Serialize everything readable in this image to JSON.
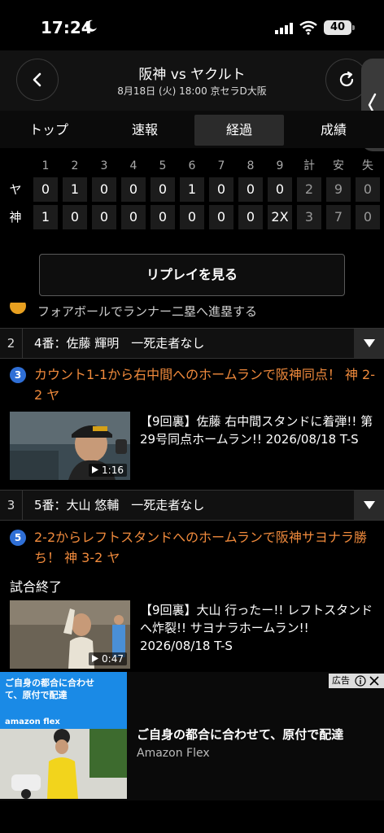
{
  "status": {
    "time": "17:24",
    "battery": "40"
  },
  "header": {
    "title": "阪神 vs ヤクルト",
    "subtitle": "8月18日 (火) 18:00 京セラD大阪"
  },
  "tabs": [
    {
      "label": "トップ"
    },
    {
      "label": "速報"
    },
    {
      "label": "経過",
      "active": true
    },
    {
      "label": "成績"
    }
  ],
  "scoreboard": {
    "headers": [
      "1",
      "2",
      "3",
      "4",
      "5",
      "6",
      "7",
      "8",
      "9",
      "計",
      "安",
      "失"
    ],
    "rows": [
      {
        "team": "ヤ",
        "cells": [
          "0",
          "1",
          "0",
          "0",
          "0",
          "1",
          "0",
          "0",
          "0",
          "2",
          "9",
          "0"
        ]
      },
      {
        "team": "神",
        "cells": [
          "1",
          "0",
          "0",
          "0",
          "0",
          "0",
          "0",
          "0",
          "2X",
          "3",
          "7",
          "0"
        ]
      }
    ]
  },
  "replay_button": "リプレイを見る",
  "partial_line": "フォアボールでランナー二塁へ進塁する",
  "batters": [
    {
      "number": "2",
      "label": "4番：佐藤 輝明　一死走者なし"
    },
    {
      "number": "3",
      "label": "5番：大山 悠輔　一死走者なし"
    }
  ],
  "plays": [
    {
      "no": "3",
      "text": "カウント1-1から右中間へのホームランで阪神同点！ 神 2-2 ヤ",
      "video_title": "【9回裏】佐藤 右中間スタンドに着弾!! 第29号同点ホームラン!! 2026/08/18 T-S",
      "duration": "1:16"
    },
    {
      "no": "5",
      "text": "2-2からレフトスタンドへのホームランで阪神サヨナラ勝ち！ 神 3-2 ヤ",
      "video_title": "【9回裏】大山 行ったー!! レフトスタンドへ炸裂!! サヨナラホームラン!! 2026/08/18 T-S",
      "duration": "0:47"
    }
  ],
  "game_end": "試合終了",
  "ad": {
    "tag": "広告",
    "image_headline": "ご自身の都合に合わせて、原付で配達",
    "image_brand": "amazon flex",
    "title": "ご自身の都合に合わせて、原付で配達",
    "sponsor": "Amazon Flex"
  }
}
